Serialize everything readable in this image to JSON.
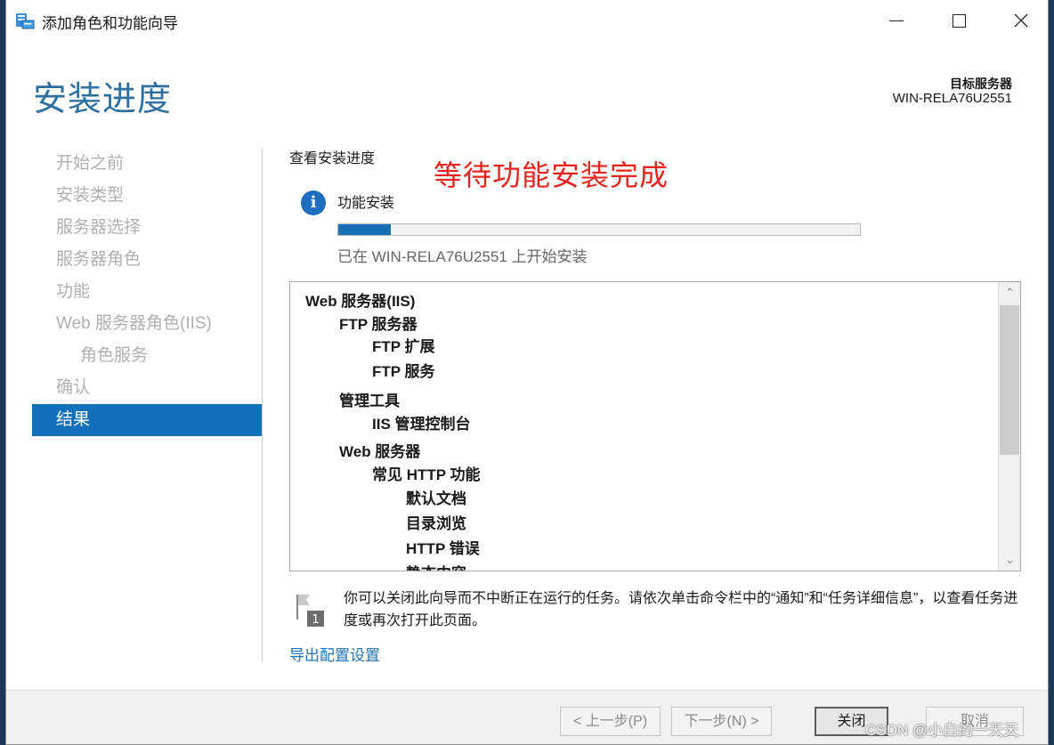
{
  "window": {
    "title": "添加角色和功能向导",
    "controls": {
      "minimize": "minimize",
      "maximize": "maximize",
      "close": "close"
    }
  },
  "header": {
    "page_title": "安装进度",
    "target_server_label": "目标服务器",
    "target_server_value": "WIN-RELA76U2551"
  },
  "sidebar": {
    "items": [
      {
        "label": "开始之前",
        "state": "disabled"
      },
      {
        "label": "安装类型",
        "state": "disabled"
      },
      {
        "label": "服务器选择",
        "state": "disabled"
      },
      {
        "label": "服务器角色",
        "state": "disabled"
      },
      {
        "label": "功能",
        "state": "disabled"
      },
      {
        "label": "Web 服务器角色(IIS)",
        "state": "disabled"
      },
      {
        "label": "角色服务",
        "state": "disabled"
      },
      {
        "label": "确认",
        "state": "disabled"
      },
      {
        "label": "结果",
        "state": "active"
      }
    ]
  },
  "main": {
    "section_heading": "查看安装进度",
    "annotation": "等待功能安装完成",
    "feature_install_label": "功能安装",
    "progress_fraction": 0.1,
    "status_text": "已在 WIN-RELA76U2551 上开始安装",
    "tree_items": [
      {
        "label": "Web 服务器(IIS)",
        "level": 0
      },
      {
        "label": "FTP 服务器",
        "level": 1
      },
      {
        "label": "FTP 扩展",
        "level": 2
      },
      {
        "label": "FTP 服务",
        "level": 2
      },
      {
        "label": "管理工具",
        "level": 1
      },
      {
        "label": "IIS 管理控制台",
        "level": 2
      },
      {
        "label": "Web 服务器",
        "level": 1
      },
      {
        "label": "常见 HTTP 功能",
        "level": 2
      },
      {
        "label": "默认文档",
        "level": 3
      },
      {
        "label": "目录浏览",
        "level": 3
      },
      {
        "label": "HTTP 错误",
        "level": 3
      },
      {
        "label": "静态内容",
        "level": 3
      }
    ],
    "notice_text": "你可以关闭此向导而不中断正在运行的任务。请依次单击命令栏中的“通知”和“任务详细信息”，以查看任务进度或再次打开此页面。",
    "notice_badge": "1",
    "export_link": "导出配置设置"
  },
  "footer": {
    "prev_label": "< 上一步(P)",
    "next_label": "下一步(N) >",
    "close_label": "关闭",
    "cancel_label": "取消"
  },
  "watermark": "CSDN @小白的一天天",
  "colors": {
    "accent": "#1270b8",
    "title_blue": "#2e6fa0",
    "annotation_red": "#e8231f",
    "progress": "#1670b3",
    "link": "#1f73b7"
  },
  "icons": {
    "app": "server-manager-icon",
    "info": "info-icon",
    "flag": "notification-flag-icon"
  }
}
